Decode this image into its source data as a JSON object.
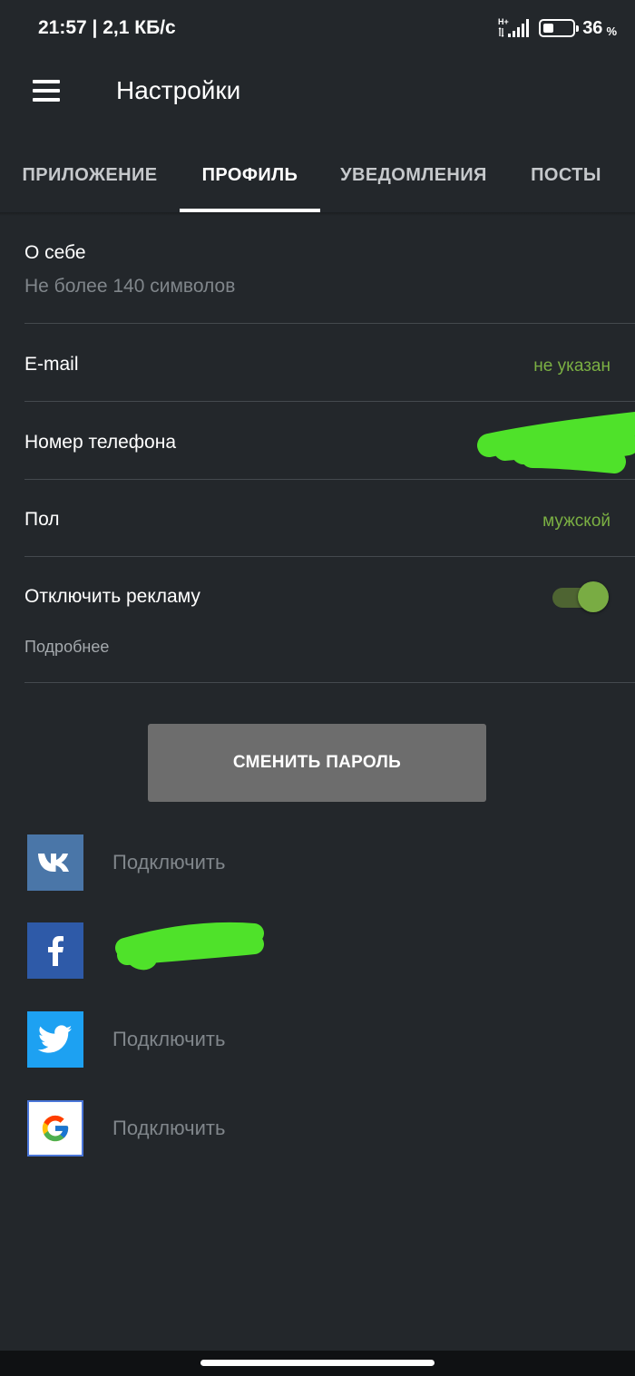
{
  "status_bar": {
    "time_and_speed": "21:57 | 2,1 КБ/с",
    "network": "H+",
    "battery_level": "36",
    "battery_unit": "%",
    "battery_fraction": 0.36
  },
  "app_bar": {
    "menu_icon": "hamburger-menu-icon",
    "title": "Настройки"
  },
  "tabs": [
    {
      "label": "ПРИЛОЖЕНИЕ",
      "active": false
    },
    {
      "label": "ПРОФИЛЬ",
      "active": true
    },
    {
      "label": "УВЕДОМЛЕНИЯ",
      "active": false
    },
    {
      "label": "ПОСТЫ",
      "active": false
    }
  ],
  "profile": {
    "about": {
      "label": "О себе",
      "placeholder": "Не более 140 символов"
    },
    "email": {
      "label": "E-mail",
      "value": "не указан"
    },
    "phone": {
      "label": "Номер телефона",
      "value_redacted": true
    },
    "gender": {
      "label": "Пол",
      "value": "мужской"
    },
    "disable_ads": {
      "label": "Отключить рекламу",
      "hint": "Подробнее",
      "enabled": true
    }
  },
  "change_password_button": "СМЕНИТЬ ПАРОЛЬ",
  "social_accounts": [
    {
      "network": "vk",
      "icon": "vk-icon",
      "status": "Подключить"
    },
    {
      "network": "facebook",
      "icon": "facebook-icon",
      "status": "",
      "account_redacted": true
    },
    {
      "network": "twitter",
      "icon": "twitter-icon",
      "status": "Подключить"
    },
    {
      "network": "google",
      "icon": "google-icon",
      "status": "Подключить"
    }
  ],
  "colors": {
    "background": "#23272b",
    "accent_green": "#7bb043",
    "redaction_green": "#4fe22a",
    "button_gray": "#6d6d6d",
    "vk_blue": "#4a76a8",
    "facebook_blue": "#2e5aa8",
    "twitter_blue": "#1da1f2"
  }
}
